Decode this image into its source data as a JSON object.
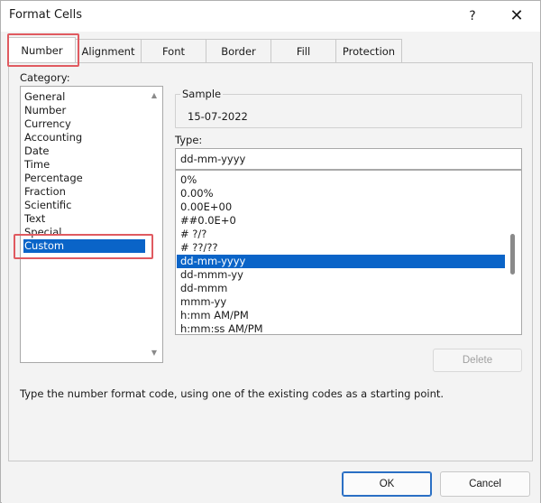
{
  "window": {
    "title": "Format Cells",
    "help_glyph": "?",
    "close_glyph": "✕"
  },
  "tabs": [
    {
      "label": "Number",
      "active": true
    },
    {
      "label": "Alignment",
      "active": false
    },
    {
      "label": "Font",
      "active": false
    },
    {
      "label": "Border",
      "active": false
    },
    {
      "label": "Fill",
      "active": false
    },
    {
      "label": "Protection",
      "active": false
    }
  ],
  "category": {
    "label": "Category:",
    "items": [
      "General",
      "Number",
      "Currency",
      "Accounting",
      "Date",
      "Time",
      "Percentage",
      "Fraction",
      "Scientific",
      "Text",
      "Special",
      "Custom"
    ],
    "selected": "Custom"
  },
  "sample": {
    "legend": "Sample",
    "value": "15-07-2022"
  },
  "type": {
    "label": "Type:",
    "value": "dd-mm-yyyy",
    "items": [
      "0%",
      "0.00%",
      "0.00E+00",
      "##0.0E+0",
      "# ?/?",
      "# ??/??",
      "dd-mm-yyyy",
      "dd-mmm-yy",
      "dd-mmm",
      "mmm-yy",
      "h:mm AM/PM",
      "h:mm:ss AM/PM"
    ],
    "selected": "dd-mm-yyyy"
  },
  "buttons": {
    "delete": "Delete",
    "ok": "OK",
    "cancel": "Cancel"
  },
  "description": "Type the number format code, using one of the existing codes as a starting point.",
  "colors": {
    "selection": "#0a64c8",
    "highlight": "#e05a60"
  }
}
